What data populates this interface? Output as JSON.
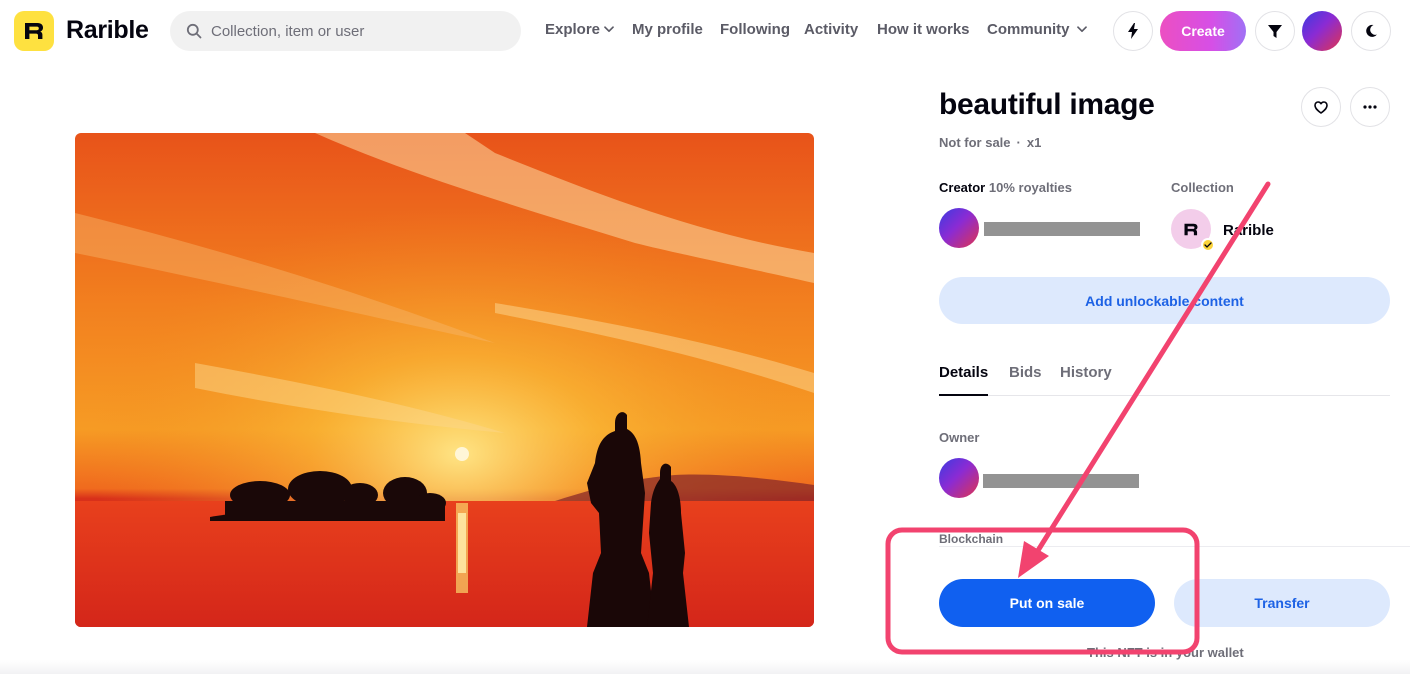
{
  "header": {
    "brand": "Rarible",
    "search_placeholder": "Collection, item or user",
    "nav": [
      {
        "label": "Explore",
        "dropdown": true
      },
      {
        "label": "My profile",
        "dropdown": false
      },
      {
        "label": "Following",
        "dropdown": false
      },
      {
        "label": "Activity",
        "dropdown": false
      },
      {
        "label": "How it works",
        "dropdown": false
      },
      {
        "label": "Community",
        "dropdown": true
      }
    ],
    "create_label": "Create",
    "icons": [
      "lightning-icon",
      "filter-icon",
      "moon-icon"
    ]
  },
  "item": {
    "title": "beautiful image",
    "sale_status": "Not for sale",
    "separator": "·",
    "edition": "x1"
  },
  "creator": {
    "label": "Creator",
    "royalties": "10% royalties"
  },
  "collection": {
    "label": "Collection",
    "name": "Rarible"
  },
  "unlockable_label": "Add unlockable content",
  "tabs": [
    {
      "label": "Details",
      "active": true
    },
    {
      "label": "Bids",
      "active": false
    },
    {
      "label": "History",
      "active": false
    }
  ],
  "owner_label": "Owner",
  "blockchain_label": "Blockchain",
  "actions": {
    "put_on_sale": "Put on sale",
    "transfer": "Transfer"
  },
  "wallet_note": "This NFT is in your wallet",
  "colors": {
    "brand_yellow": "#fee140",
    "primary_blue": "#1060f0",
    "light_blue": "#dde9fd",
    "annotation_pink": "#f2436f"
  }
}
